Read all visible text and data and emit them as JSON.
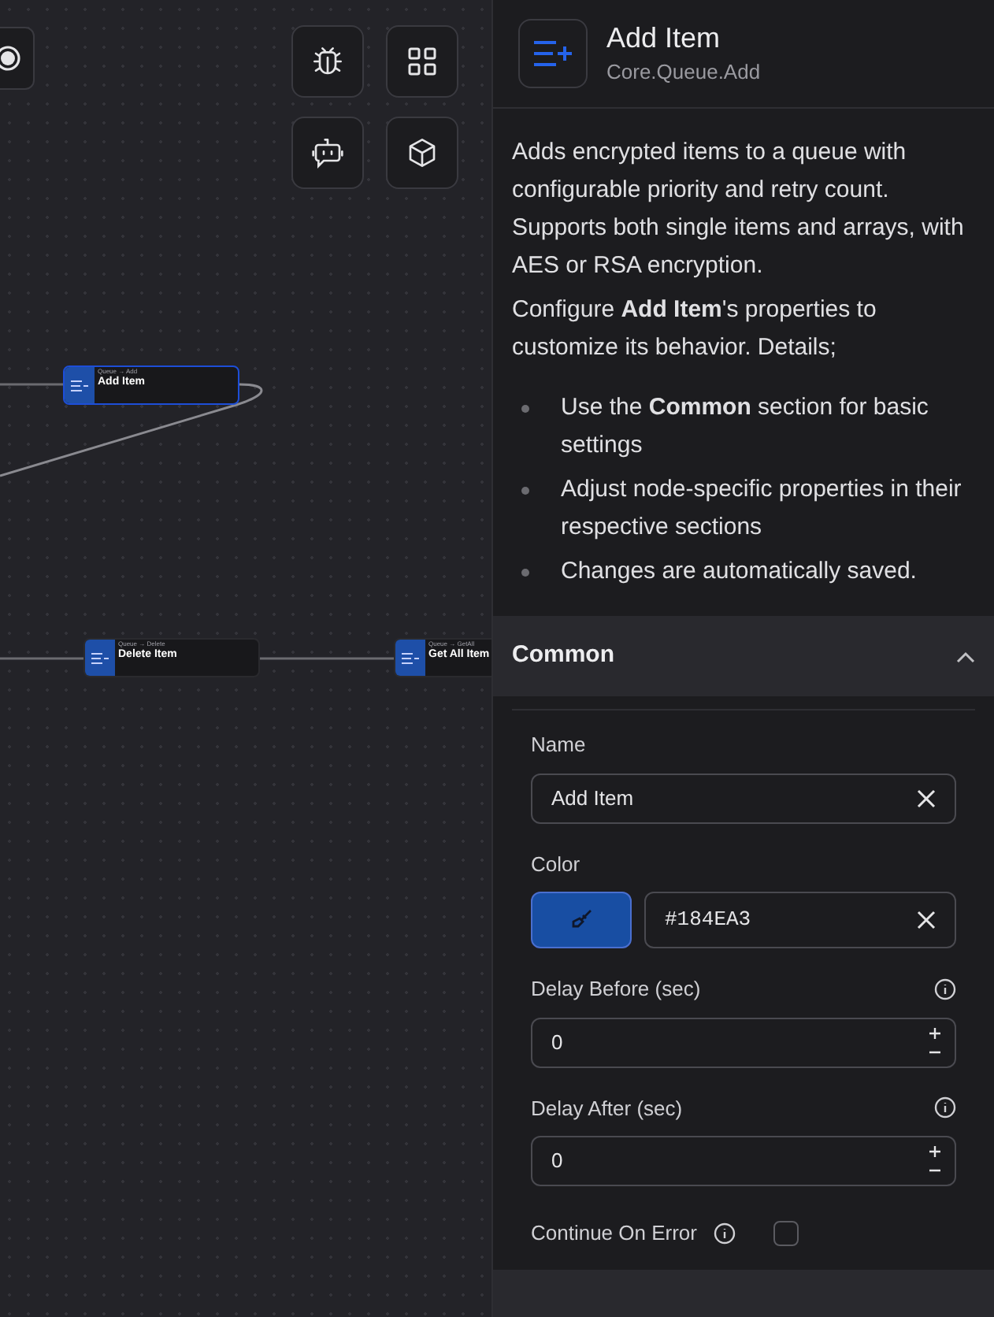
{
  "canvas": {
    "nodes": [
      {
        "category": "Queue → Add",
        "label": "Add Item",
        "selected": true
      },
      {
        "category": "Queue → Delete",
        "label": "Delete Item",
        "selected": false
      },
      {
        "category": "Queue → GetAll",
        "label": "Get All Item",
        "selected": false
      }
    ]
  },
  "panel": {
    "title": "Add Item",
    "subtitle": "Core.Queue.Add",
    "description": "Adds encrypted items to a queue with configurable priority and retry count. Supports both single items and arrays, with AES or RSA encryption.",
    "configure": "Configure **Add Item**'s properties to customize its behavior. Details;",
    "bullets": [
      "Use the **Common** section for basic settings",
      "Adjust node-specific properties in their respective sections",
      "Changes are automatically saved."
    ],
    "section": {
      "title": "Common",
      "expanded": true,
      "fields": [
        {
          "kind": "text",
          "label": "Name",
          "value": "Add Item"
        },
        {
          "kind": "color",
          "label": "Color",
          "value": "#184EA3"
        },
        {
          "kind": "number",
          "label": "Delay Before (sec)",
          "value": "0",
          "info": true
        },
        {
          "kind": "number",
          "label": "Delay After (sec)",
          "value": "0",
          "info": true
        },
        {
          "kind": "checkbox",
          "label": "Continue On Error",
          "checked": false,
          "info": true
        }
      ]
    }
  }
}
